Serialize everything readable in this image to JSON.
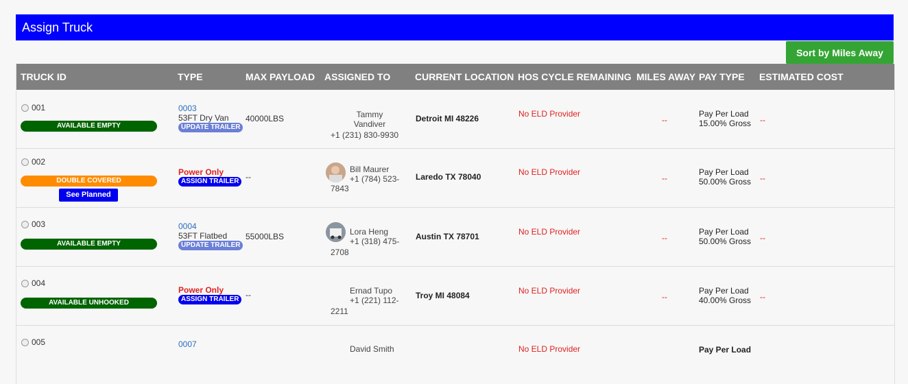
{
  "header": {
    "title": "Assign Truck",
    "sort_label": "Sort by Miles Away"
  },
  "columns": [
    "TRUCK ID",
    "TYPE",
    "MAX PAYLOAD",
    "ASSIGNED TO",
    "CURRENT LOCATION",
    "HOS CYCLE REMAINING",
    "MILES AWAY",
    "PAY TYPE",
    "ESTIMATED COST"
  ],
  "colors": {
    "title_bg": "#0000ff",
    "header_bg": "#808080",
    "green": "#006400",
    "orange": "#ff8c00",
    "link": "#2a6ebb",
    "error": "#e02020",
    "sort_btn": "#34a534"
  },
  "rows": [
    {
      "id": "001",
      "status": "AVAILABLE EMPTY",
      "trailer_no": "0003",
      "trailer_type": "53FT Dry Van",
      "trailer_action": "UPDATE TRAILER",
      "payload": "40000LBS",
      "driver_line1": "Tammy",
      "driver_line2": "Vandiver",
      "phone": "+1 (231) 830-9930",
      "location": "Detroit MI 48226",
      "hos": "No ELD Provider",
      "miles": "--",
      "pay_type": "Pay Per Load",
      "pay_rate": "15.00% Gross",
      "cost": "--"
    },
    {
      "id": "002",
      "status": "DOUBLE COVERED",
      "planned_label": "See Planned",
      "type_label": "Power Only",
      "trailer_action": "ASSIGN TRAILER",
      "payload": "--",
      "driver": "Bill Maurer",
      "phone_a": "+1 (784) 523-",
      "phone_b": "7843",
      "location": "Laredo TX 78040",
      "hos": "No ELD Provider",
      "miles": "--",
      "pay_type": "Pay Per Load",
      "pay_rate": "50.00% Gross",
      "cost": "--"
    },
    {
      "id": "003",
      "status": "AVAILABLE EMPTY",
      "trailer_no": "0004",
      "trailer_type": "53FT Flatbed",
      "trailer_action": "UPDATE TRAILER",
      "payload": "55000LBS",
      "driver": "Lora Heng",
      "phone_a": "+1 (318) 475-",
      "phone_b": "2708",
      "location": "Austin TX 78701",
      "hos": "No ELD Provider",
      "miles": "--",
      "pay_type": "Pay Per Load",
      "pay_rate": "50.00% Gross",
      "cost": "--"
    },
    {
      "id": "004",
      "status": "AVAILABLE UNHOOKED",
      "type_label": "Power Only",
      "trailer_action": "ASSIGN TRAILER",
      "payload": "--",
      "driver": "Ernad Tupo",
      "phone_a": "+1 (221) 112-",
      "phone_b": "2211",
      "location": "Troy MI 48084",
      "hos": "No ELD Provider",
      "miles": "--",
      "pay_type": "Pay Per Load",
      "pay_rate": "40.00% Gross",
      "cost": "--"
    },
    {
      "id": "005",
      "trailer_no": "0007",
      "driver": "David Smith",
      "hos": "No ELD Provider",
      "pay_type": "Pay Per Load"
    }
  ]
}
